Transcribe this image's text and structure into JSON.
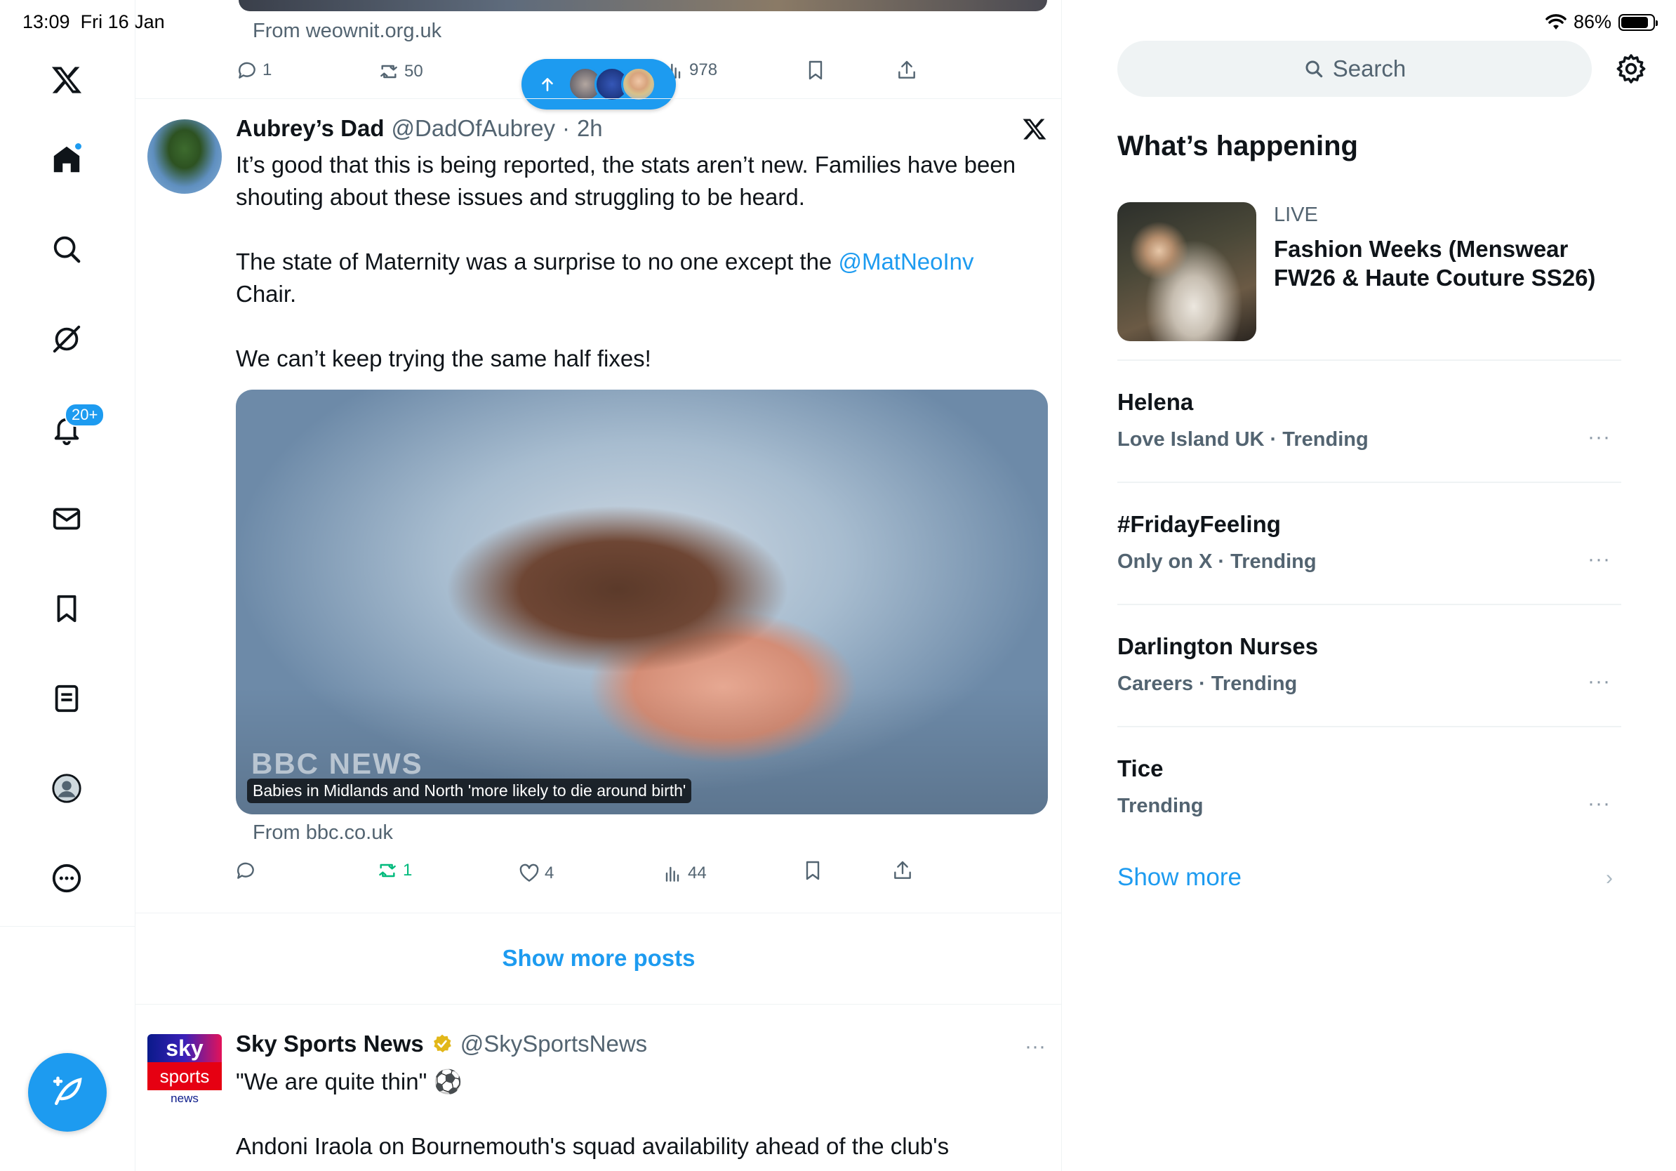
{
  "status_bar": {
    "time": "13:09",
    "date": "Fri 16 Jan",
    "battery": "86%"
  },
  "nav": {
    "notifications_badge": "20+",
    "items": [
      "x-logo",
      "home-icon",
      "search-icon",
      "grok-icon",
      "bell-icon",
      "mail-icon",
      "bookmark-icon",
      "lists-icon",
      "profile-icon",
      "more-icon"
    ]
  },
  "top_post": {
    "from": "From weownit.org.uk",
    "replies": "1",
    "reposts": "50",
    "views": "978"
  },
  "post": {
    "name": "Aubrey’s Dad",
    "handle": "@DadOfAubrey",
    "time": "2h",
    "sep": "·",
    "para1": "It’s good that this is being reported, the stats aren’t new. Families have been shouting about these issues and struggling to be heard.",
    "para2_before": "The state of Maternity was a surprise to no one except the ",
    "para2_mention": "@MatNeoInv",
    "para2_after": "Chair.",
    "para3": "We can’t keep trying the same half fixes!",
    "media_caption": "Babies in Midlands and North 'more likely to die around birth'",
    "media_watermark": "BBC NEWS",
    "from": "From bbc.co.uk",
    "reposts": "1",
    "likes": "4",
    "views": "44"
  },
  "show_more_posts": "Show more posts",
  "next_post": {
    "name": "Sky Sports News",
    "handle": "@SkySportsNews",
    "text1": "\"We are quite thin\" ⚽",
    "text2": "Andoni Iraola on Bournemouth's squad availability ahead of the club's",
    "logo_sky": "sky",
    "logo_sports": "sports",
    "logo_news": "news"
  },
  "sidebar": {
    "search_placeholder": "Search",
    "title": "What’s happening",
    "live": {
      "label": "LIVE",
      "title": "Fashion Weeks (Menswear FW26 & Haute Couture SS26)"
    },
    "trends": [
      {
        "name": "Helena",
        "meta": "Love Island UK · Trending"
      },
      {
        "name": "#FridayFeeling",
        "meta": "Only on X · Trending"
      },
      {
        "name": "Darlington Nurses",
        "meta": "Careers · Trending"
      },
      {
        "name": "Tice",
        "meta": "Trending"
      }
    ],
    "more_dots": "···",
    "show_more": "Show more",
    "chevron": "›"
  },
  "colors": {
    "accent": "#1d9bf0",
    "repost_green": "#00ba7c",
    "muted": "#536471"
  }
}
